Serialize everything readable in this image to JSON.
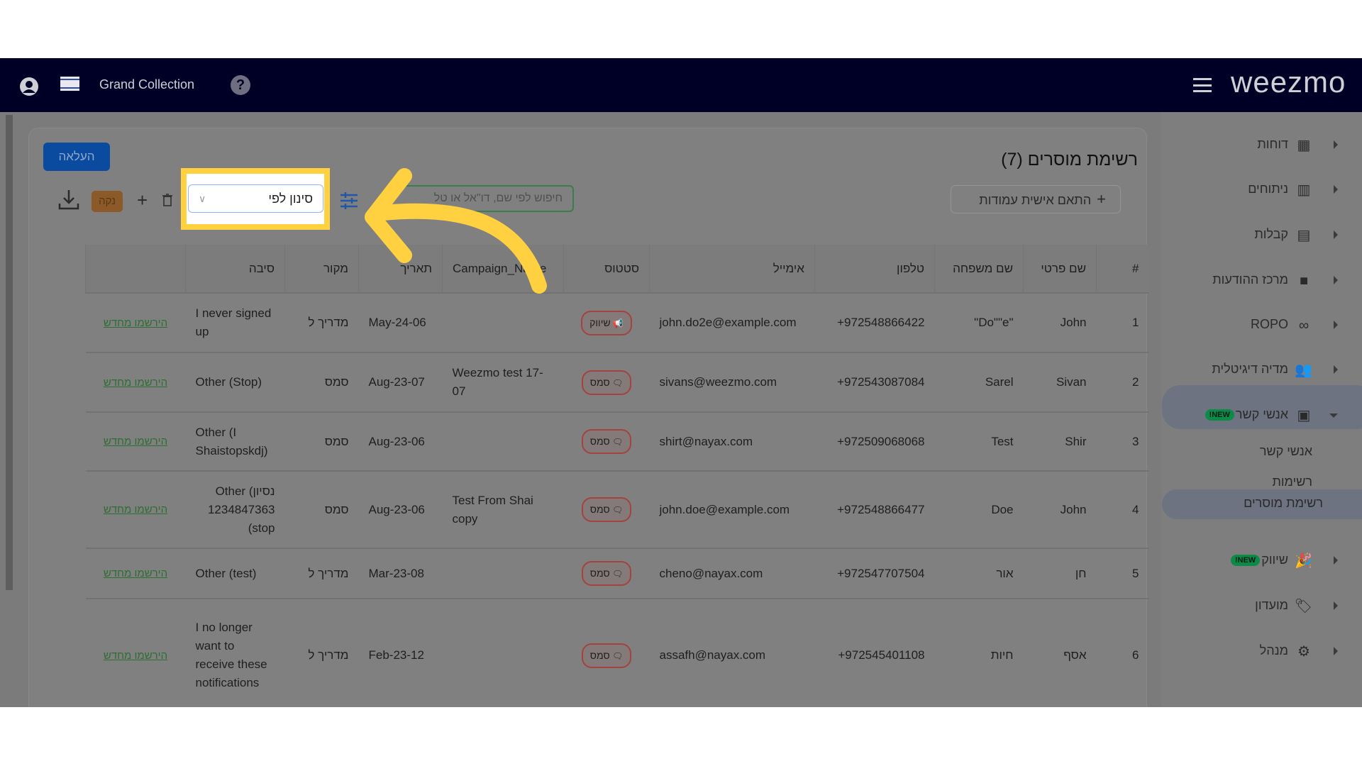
{
  "nav": {
    "store": "Grand Collection",
    "logo": "weezmo",
    "icons": [
      "user-icon",
      "israel-flag-icon",
      "help-icon",
      "menu-icon"
    ]
  },
  "toolbar": {
    "upload": "העלאה",
    "clear": "נקה",
    "filter_placeholder": "סינון לפי",
    "search_placeholder": "חיפוש לפי שם, דו\"אל או טל",
    "customize": "התאם אישית עמודות"
  },
  "page": {
    "title": "רשימת מוסרים (7)"
  },
  "table": {
    "headers": [
      "#",
      "שם פרטי",
      "שם משפחה",
      "טלפון",
      "אימייל",
      "סטטוס",
      "Campaign_Name",
      "תאריך",
      "מקור",
      "סיבה",
      ""
    ],
    "rows": [
      {
        "n": "1",
        "first": "John",
        "last": "\"Do\"\"e\"",
        "phone": "972548866422+",
        "email": "john.do2e@example.com",
        "status": "שיווק",
        "status_icon": "megaphone-icon",
        "campaign": "",
        "date": "May-24-06",
        "source": "מדריך ל",
        "reason": "I never signed up",
        "action": "הירשמו מחדש"
      },
      {
        "n": "2",
        "first": "Sivan",
        "last": "Sarel",
        "phone": "972543087084+",
        "email": "sivans@weezmo.com",
        "status": "סמס",
        "status_icon": "chat-icon",
        "campaign": "Weezmo test 17-07",
        "date": "Aug-23-07",
        "source": "סמס",
        "reason": "Other (Stop)",
        "action": "הירשמו מחדש"
      },
      {
        "n": "3",
        "first": "Shir",
        "last": "Test",
        "phone": "972509068068+",
        "email": "shirt@nayax.com",
        "status": "סמס",
        "status_icon": "chat-icon",
        "campaign": "",
        "date": "Aug-23-06",
        "source": "סמס",
        "reason": "Other (I Shaistopskdj)",
        "action": "הירשמו מחדש"
      },
      {
        "n": "4",
        "first": "John",
        "last": "Doe",
        "phone": "972548866477+",
        "email": "john.doe@example.com",
        "status": "סמס",
        "status_icon": "chat-icon",
        "campaign": "Test From Shai copy",
        "date": "Aug-23-06",
        "source": "סמס",
        "reason": "נסיון) Other 1234847363 (stop",
        "action": "הירשמו מחדש"
      },
      {
        "n": "5",
        "first": "חן",
        "last": "אור",
        "phone": "972547707504+",
        "email": "cheno@nayax.com",
        "status": "סמס",
        "status_icon": "chat-icon",
        "campaign": "",
        "date": "Mar-23-08",
        "source": "מדריך ל",
        "reason": "Other (test)",
        "action": "הירשמו מחדש"
      },
      {
        "n": "6",
        "first": "אסף",
        "last": "חיות",
        "phone": "972545401108+",
        "email": "assafh@nayax.com",
        "status": "סמס",
        "status_icon": "chat-icon",
        "campaign": "",
        "date": "Feb-23-12",
        "source": "מדריך ל",
        "reason": "I no longer want to receive these notifications",
        "action": "הירשמו מחדש"
      }
    ]
  },
  "sidebar": {
    "items": [
      {
        "label": "דוחות",
        "icon": "dashboard-icon"
      },
      {
        "label": "ניתוחים",
        "icon": "bar-chart-icon"
      },
      {
        "label": "קבלות",
        "icon": "receipt-icon"
      },
      {
        "label": "מרכז ההודעות",
        "icon": "message-icon"
      },
      {
        "label": "ROPO",
        "icon": "infinity-icon"
      },
      {
        "label": "מדיה דיגיטלית",
        "icon": "people-icon"
      },
      {
        "label": "אנשי קשר",
        "icon": "contacts-icon",
        "badge": "NEW!"
      },
      {
        "label": "שיווק",
        "icon": "party-icon",
        "badge": "NEW!"
      },
      {
        "label": "מועדון",
        "icon": "tag-heart-icon"
      },
      {
        "label": "מנהל",
        "icon": "gear-icon"
      }
    ],
    "subitems": [
      "אנשי קשר",
      "רשימות",
      "רשימת מוסרים"
    ]
  },
  "colors": {
    "nav": "#000026",
    "highlight": "#ffd03f",
    "new_badge": "#0c8a48",
    "upload": "#0b4fa8"
  }
}
